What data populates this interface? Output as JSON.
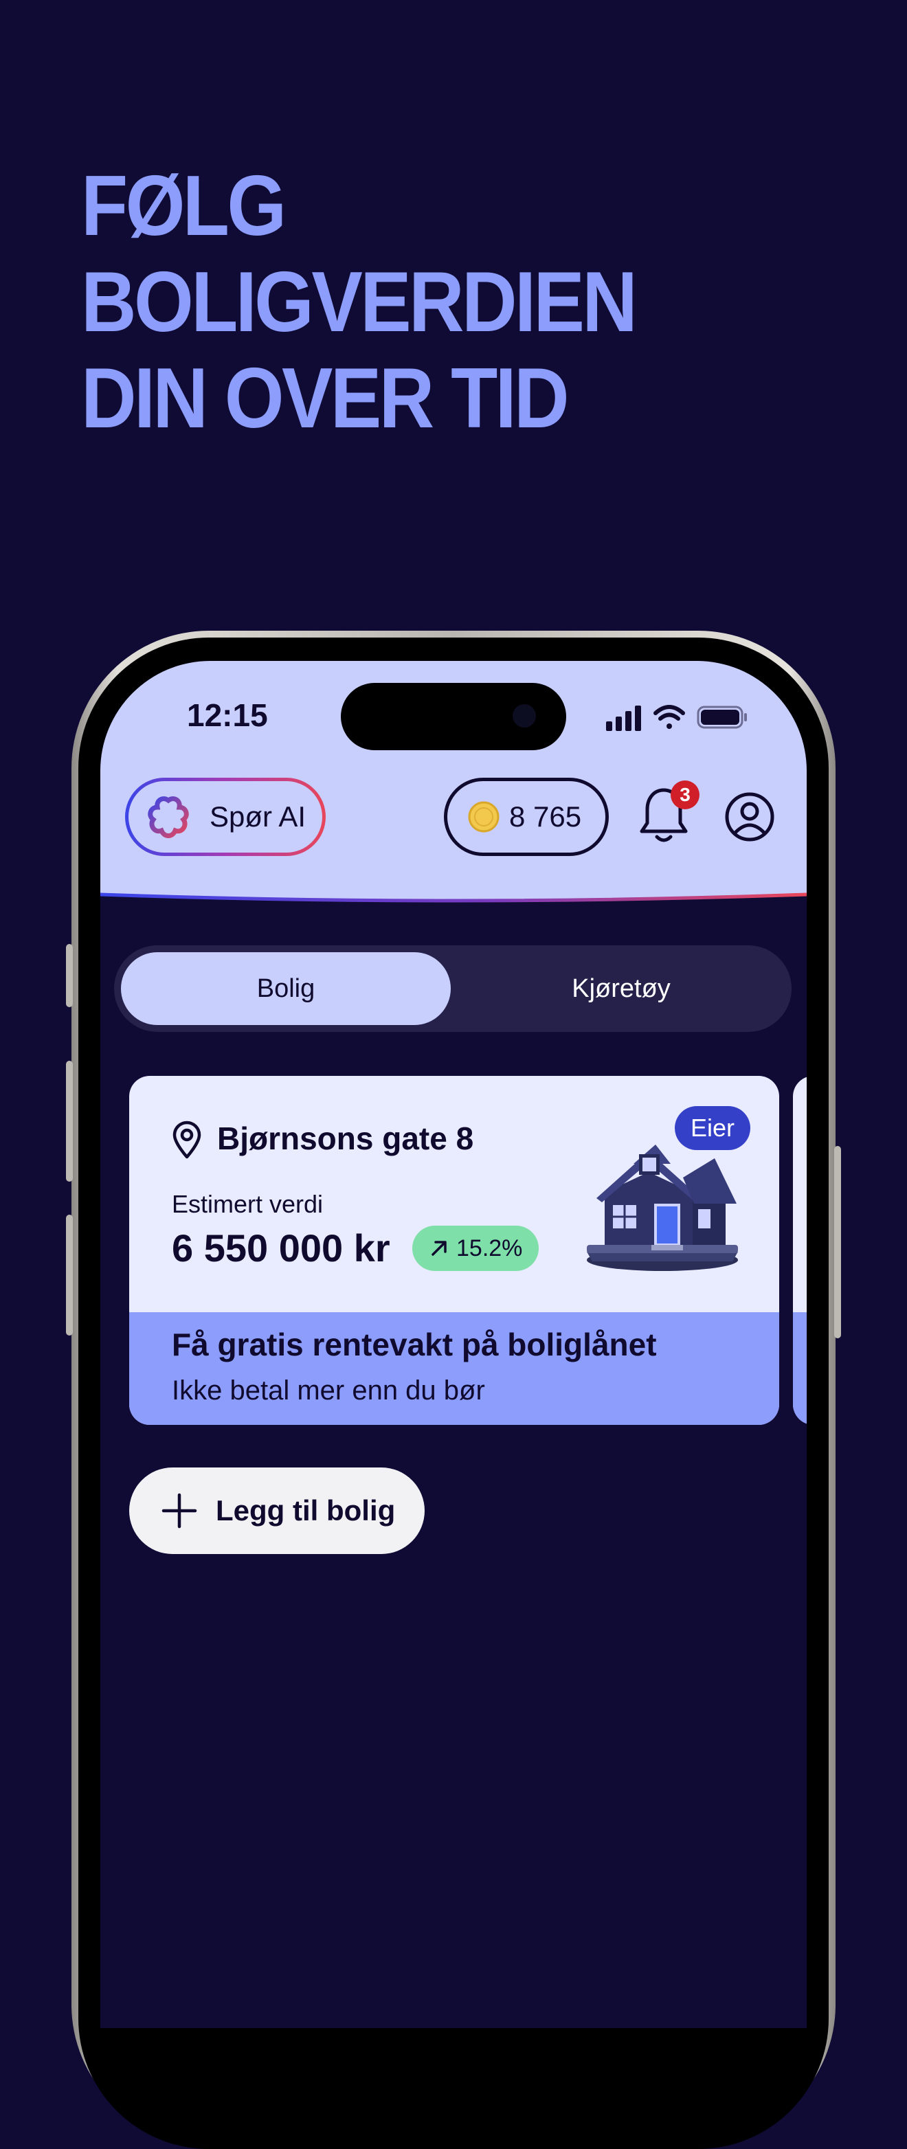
{
  "promo": {
    "headline_line1": "FØLG BOLIGVERDIEN",
    "headline_line2": "DIN OVER TID"
  },
  "status_bar": {
    "time": "12:15"
  },
  "header": {
    "ai_button_label": "Spør AI",
    "coins_value": "8 765",
    "notification_count": "3",
    "icons": [
      "ai-flower-icon",
      "coin-icon",
      "bell-icon",
      "profile-icon"
    ]
  },
  "tabs": [
    {
      "label": "Bolig",
      "selected": true
    },
    {
      "label": "Kjøretøy",
      "selected": false
    }
  ],
  "property_card": {
    "address": "Bjørnsons gate 8",
    "owner_badge": "Eier",
    "estimate_label": "Estimert verdi",
    "estimate_value": "6 550 000 kr",
    "change_value": "15.2%",
    "promo_title": "Få gratis rentevakt på boliglånet",
    "promo_subtitle": "Ikke betal mer enn du bør"
  },
  "add_property_label": "Legg til bolig",
  "colors": {
    "background": "#100b35",
    "headline": "#8d9dfb",
    "header_bg": "#c9cffd",
    "card_bg": "#e9ebff",
    "promo_band": "#8d9dfb",
    "change_pill": "#7ee0a8",
    "owner_badge": "#3540c8",
    "badge_red": "#d11f2a"
  }
}
